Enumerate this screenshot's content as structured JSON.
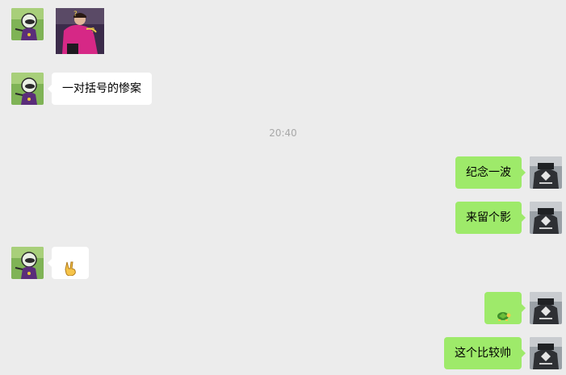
{
  "messages": [
    {
      "side": "left",
      "type": "image",
      "avatar": "contact-avatar",
      "icon": "photo-image"
    },
    {
      "side": "left",
      "type": "text",
      "avatar": "contact-avatar",
      "text": "一对括号的惨案"
    },
    {
      "type": "time",
      "text": "20:40"
    },
    {
      "side": "right",
      "type": "text",
      "avatar": "self-avatar",
      "text": "纪念一波"
    },
    {
      "side": "right",
      "type": "text",
      "avatar": "self-avatar",
      "text": "来留个影"
    },
    {
      "side": "left",
      "type": "emoji",
      "avatar": "contact-avatar",
      "icon": "victory-hand-icon"
    },
    {
      "side": "right",
      "type": "emoji",
      "avatar": "self-avatar",
      "icon": "turtle-icon"
    },
    {
      "side": "right",
      "type": "text",
      "avatar": "self-avatar",
      "text": "这个比较帅"
    }
  ],
  "colors": {
    "background": "#ececec",
    "self_bubble": "#9eea6a",
    "other_bubble": "#ffffff",
    "timestamp": "#a8a8a8"
  }
}
